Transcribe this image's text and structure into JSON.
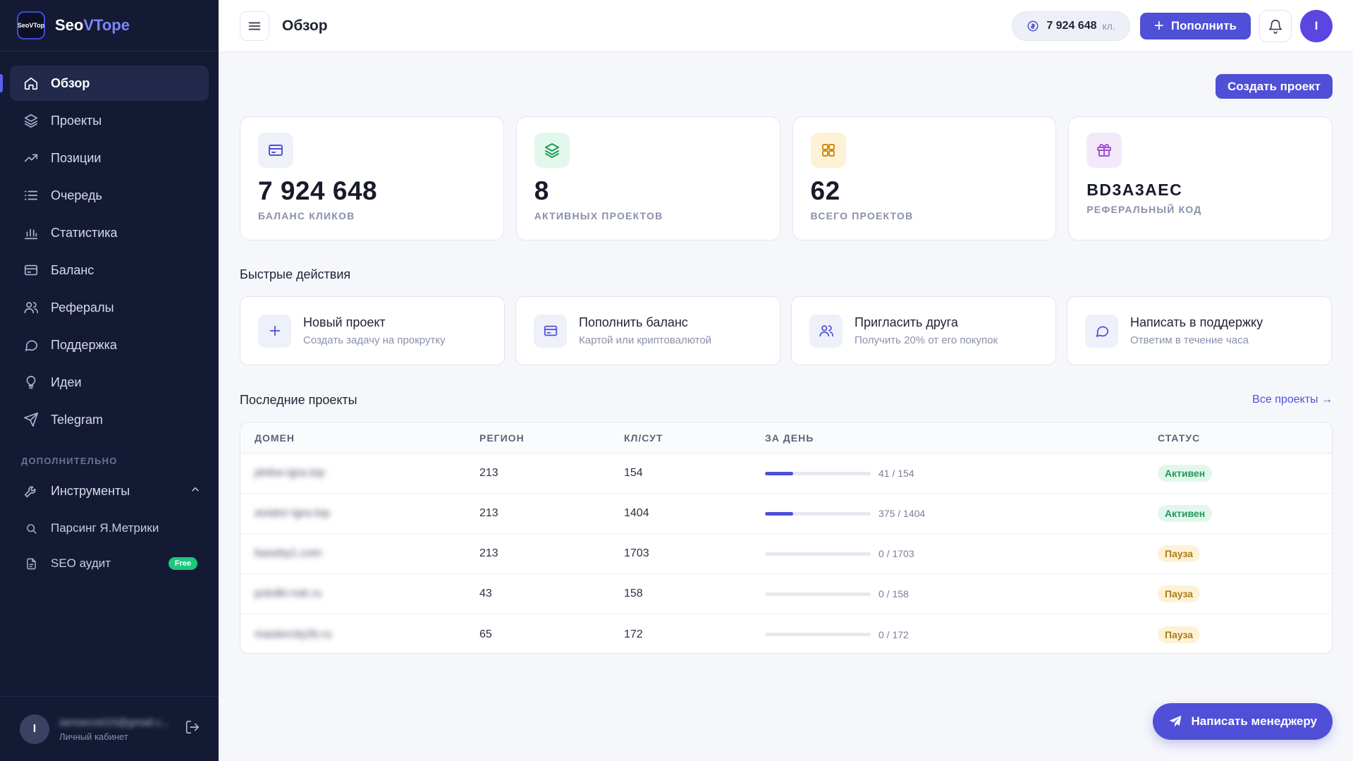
{
  "brand": {
    "badge": "SeoVTop",
    "name_main": "Seo",
    "name_accent": "VTope"
  },
  "sidebar": {
    "items": [
      {
        "label": "Обзор",
        "icon": "home-icon",
        "active": true
      },
      {
        "label": "Проекты",
        "icon": "layers-icon"
      },
      {
        "label": "Позиции",
        "icon": "trend-icon"
      },
      {
        "label": "Очередь",
        "icon": "list-icon"
      },
      {
        "label": "Статистика",
        "icon": "bar-chart-icon"
      },
      {
        "label": "Баланс",
        "icon": "card-icon"
      },
      {
        "label": "Рефералы",
        "icon": "users-icon"
      },
      {
        "label": "Поддержка",
        "icon": "chat-icon"
      },
      {
        "label": "Идеи",
        "icon": "bulb-icon"
      },
      {
        "label": "Telegram",
        "icon": "send-icon"
      }
    ],
    "section_label": "ДОПОЛНИТЕЛЬНО",
    "tools": {
      "label": "Инструменты",
      "icon": "wrench-icon"
    },
    "sub_items": [
      {
        "label": "Парсинг Я.Метрики",
        "icon": "search-icon"
      },
      {
        "label": "SEO аудит",
        "icon": "file-icon",
        "badge": "Free"
      }
    ],
    "user": {
      "initial": "I",
      "email": "iamsecret15@gmail.c...",
      "role": "Личный кабинет"
    }
  },
  "header": {
    "title": "Обзор",
    "balance": "7 924 648",
    "balance_unit": "кл.",
    "topup_label": "Пополнить",
    "avatar_initial": "I"
  },
  "main": {
    "create_label": "Создать проект",
    "stats": [
      {
        "value": "7 924 648",
        "label": "БАЛАНС КЛИКОВ",
        "icon": "card-icon",
        "bg": "#eef0fa",
        "color": "#4f4fd8"
      },
      {
        "value": "8",
        "label": "АКТИВНЫХ ПРОЕКТОВ",
        "icon": "layers-icon",
        "bg": "#e2f7ec",
        "color": "#1f9a5b"
      },
      {
        "value": "62",
        "label": "ВСЕГО ПРОЕКТОВ",
        "icon": "grid-icon",
        "bg": "#fdf2d6",
        "color": "#d08a12"
      },
      {
        "value": "BD3A3AEC",
        "label": "РЕФЕРАЛЬНЫЙ КОД",
        "icon": "gift-icon",
        "bg": "#f3e9fb",
        "color": "#9b4fd8"
      }
    ],
    "quick_title": "Быстрые действия",
    "quick": [
      {
        "title": "Новый проект",
        "sub": "Создать задачу на прокрутку",
        "icon": "plus-icon"
      },
      {
        "title": "Пополнить баланс",
        "sub": "Картой или криптовалютой",
        "icon": "card-icon"
      },
      {
        "title": "Пригласить друга",
        "sub": "Получить 20% от его покупок",
        "icon": "users-icon"
      },
      {
        "title": "Написать в поддержку",
        "sub": "Ответим в течение часа",
        "icon": "chat-icon"
      }
    ],
    "recent_title": "Последние проекты",
    "all_projects_label": "Все проекты →",
    "table": {
      "headers": [
        "ДОМЕН",
        "РЕГИОН",
        "КЛ/СУТ",
        "ЗА ДЕНЬ",
        "СТАТУС"
      ],
      "rows": [
        {
          "domain": "plnkw-igra.top",
          "region": "213",
          "clicks": "154",
          "progress_text": "41 / 154",
          "progress": 0.266,
          "status": "Активен",
          "status_type": "active"
        },
        {
          "domain": "aviator-igra.top",
          "region": "213",
          "clicks": "1404",
          "progress_text": "375 / 1404",
          "progress": 0.267,
          "status": "Активен",
          "status_type": "active"
        },
        {
          "domain": "baseby1.com",
          "region": "213",
          "clicks": "1703",
          "progress_text": "0 / 1703",
          "progress": 0,
          "status": "Пауза",
          "status_type": "pause"
        },
        {
          "domain": "potolki-nsk.ru",
          "region": "43",
          "clicks": "158",
          "progress_text": "0 / 158",
          "progress": 0,
          "status": "Пауза",
          "status_type": "pause"
        },
        {
          "domain": "mastercity2b.ru",
          "region": "65",
          "clicks": "172",
          "progress_text": "0 / 172",
          "progress": 0,
          "status": "Пауза",
          "status_type": "pause"
        }
      ]
    },
    "manager_label": "Написать менеджеру"
  }
}
